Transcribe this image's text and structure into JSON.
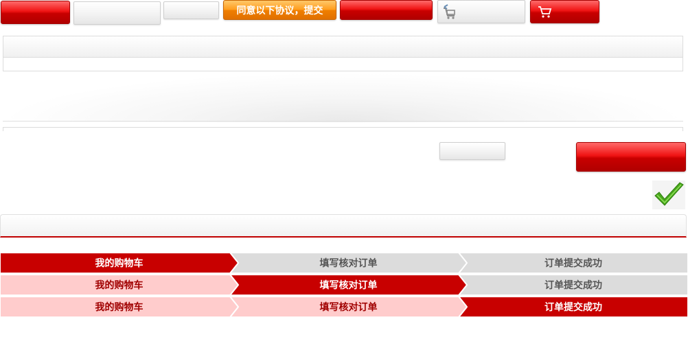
{
  "top_buttons": {
    "agree_submit_label": "同意以下协议，提交"
  },
  "icons": {
    "cart_back": "cart-return-icon",
    "cart": "cart-icon",
    "check": "checkmark-icon"
  },
  "steps": {
    "labels": [
      "我的购物车",
      "填写核对订单",
      "订单提交成功"
    ],
    "rows": [
      {
        "active_index": 0
      },
      {
        "active_index": 1
      },
      {
        "active_index": 2
      }
    ]
  },
  "colors": {
    "active": "#c80000",
    "done": "#ffcccc",
    "pending": "#dcdcdc",
    "active_text": "#ffffff",
    "done_text": "#a00000",
    "pending_text": "#555555"
  }
}
